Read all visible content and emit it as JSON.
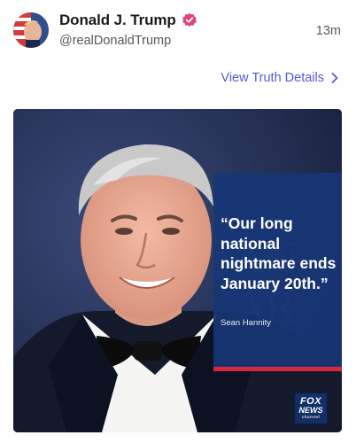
{
  "post": {
    "author_name": "Donald J. Trump",
    "handle": "@realDonaldTrump",
    "timestamp": "13m",
    "verified_icon": "verified-badge-icon",
    "avatar_icon": "avatar"
  },
  "details_link": {
    "label": "View Truth Details",
    "icon": "chevron-right-icon"
  },
  "media": {
    "quote": "“Our long national nightmare ends January 20th.”",
    "quote_author": "Sean Hannity",
    "logo": {
      "line1": "FOX",
      "line2": "NEWS",
      "line3": "channel"
    }
  },
  "colors": {
    "link": "#5b55d6",
    "verified": "#e3437d",
    "quote_card": "#173778",
    "accent_red": "#d6283a"
  }
}
